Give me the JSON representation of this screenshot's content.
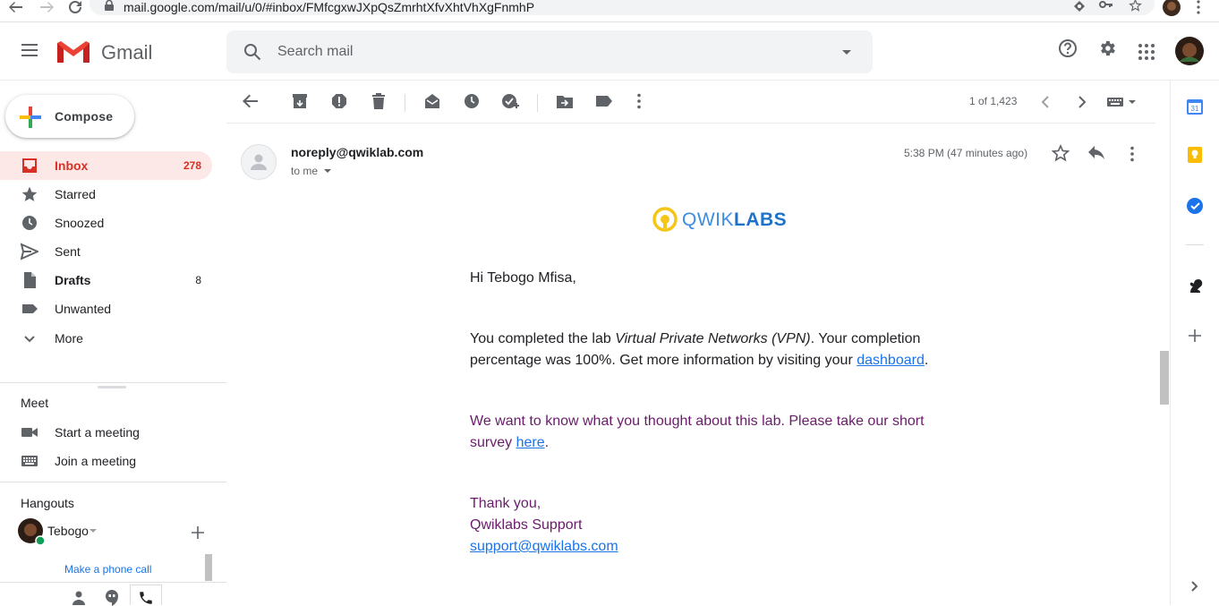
{
  "browser": {
    "url": "mail.google.com/mail/u/0/#inbox/FMfcgxwJXpQsZmrhtXfvXhtVhXgFnmhP"
  },
  "header": {
    "brand": "Gmail",
    "search_placeholder": "Search mail"
  },
  "compose": {
    "label": "Compose"
  },
  "nav": [
    {
      "label": "Inbox",
      "count": "278",
      "icon": "inbox-icon",
      "active": true
    },
    {
      "label": "Starred",
      "count": "",
      "icon": "star-icon"
    },
    {
      "label": "Snoozed",
      "count": "",
      "icon": "clock-icon"
    },
    {
      "label": "Sent",
      "count": "",
      "icon": "send-icon"
    },
    {
      "label": "Drafts",
      "count": "8",
      "icon": "draft-icon",
      "bold": true
    },
    {
      "label": "Unwanted",
      "count": "",
      "icon": "label-icon"
    },
    {
      "label": "More",
      "count": "",
      "icon": "chevron-down-icon"
    }
  ],
  "meet": {
    "title": "Meet",
    "items": [
      "Start a meeting",
      "Join a meeting"
    ]
  },
  "hangouts": {
    "title": "Hangouts",
    "user": "Tebogo",
    "phone_call": "Make a phone call"
  },
  "toolbar": {
    "page_count": "1 of 1,423"
  },
  "message": {
    "sender": "noreply@qwiklab.com",
    "to": "to me",
    "time": "5:38 PM (47 minutes ago)",
    "logo_light": "QWIK",
    "logo_bold": "LABS",
    "greeting": "Hi Tebogo Mfisa,",
    "p1_a": "You completed the lab ",
    "p1_lab": "Virtual Private Networks (VPN)",
    "p1_b": ". Your completion percentage was 100%. Get more information by visiting your ",
    "p1_link": "dashboard",
    "p1_end": ".",
    "p2_a": "We want to know what you thought about this lab. Please take our short survey ",
    "p2_link": "here",
    "p2_end": ".",
    "thanks": "Thank you,",
    "signature": "Qwiklabs Support",
    "support_email": "support@qwiklabs.com"
  },
  "colors": {
    "accent_red": "#d93025",
    "link_blue": "#1a73e8",
    "survey_purple": "#6a1b6a"
  }
}
